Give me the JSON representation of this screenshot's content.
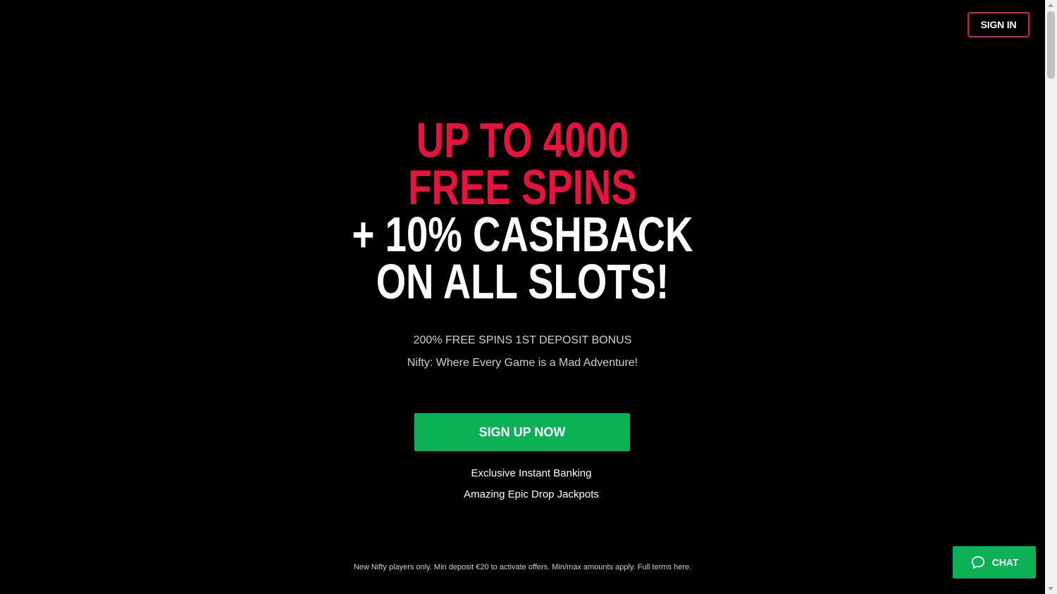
{
  "header": {
    "sign_in_label": "SIGN IN"
  },
  "hero": {
    "line1": "UP TO 4000",
    "line2": "FREE SPINS",
    "line3": "+ 10% CASHBACK",
    "line4": "ON ALL SLOTS!",
    "subtitle1": "200% FREE SPINS 1ST DEPOSIT BONUS",
    "subtitle2": "Nifty: Where Every Game is a Mad Adventure!"
  },
  "cta": {
    "sign_up_label": "SIGN UP NOW"
  },
  "features": [
    "Exclusive Instant Banking",
    "Amazing Epic Drop Jackpots"
  ],
  "footer": {
    "disclaimer": "New Nifty players only. Min deposit €20 to activate offers. Min/max amounts apply.",
    "terms_link": "Full terms here."
  },
  "chat": {
    "label": "CHAT",
    "icon": "chat-bubble-icon"
  },
  "colors": {
    "accent_red": "#e8133d",
    "accent_green": "#0db155",
    "background": "#000000"
  }
}
